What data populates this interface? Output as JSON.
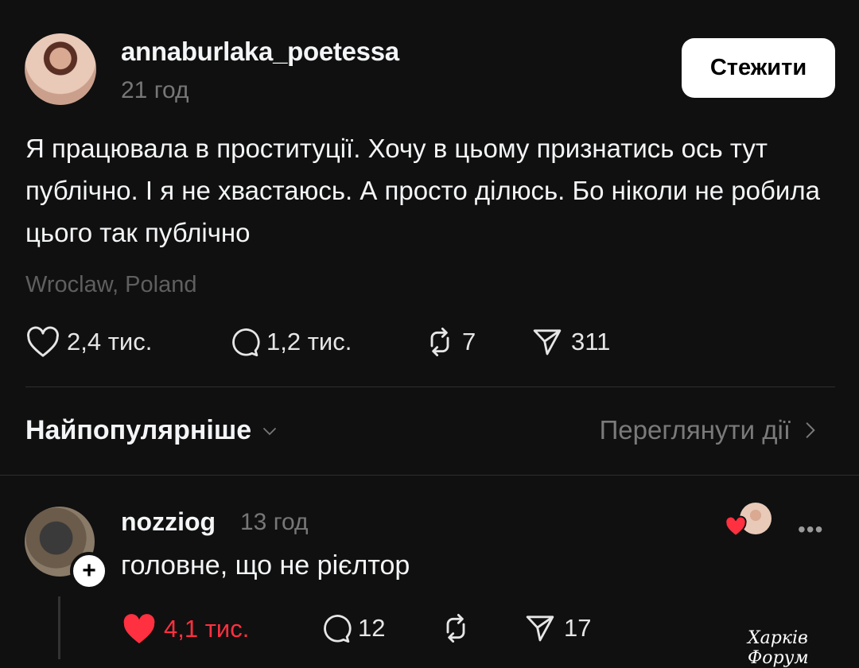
{
  "post": {
    "username": "annaburlaka_poetessa",
    "time": "21 год",
    "follow_label": "Стежити",
    "text": "Я працювала в проституції. Хочу в цьому признатись ось тут публічно. І я не хвастаюсь. А просто ділюсь. Бо ніколи не робила цього так публічно",
    "location": "Wroclaw, Poland",
    "stats": {
      "likes": "2,4 тис.",
      "comments": "1,2 тис.",
      "reposts": "7",
      "shares": "311"
    },
    "icons": [
      "heart-icon",
      "comment-icon",
      "repost-icon",
      "share-icon"
    ]
  },
  "sort": {
    "label": "Найпопулярніше",
    "activity_label": "Переглянути дії"
  },
  "comment": {
    "username": "nozziog",
    "time": "13 год",
    "text": "головне, що не рієлтор",
    "plus": "+",
    "more": "•••",
    "stats": {
      "likes": "4,1 тис.",
      "comments": "12",
      "shares": "17"
    }
  },
  "watermark": "Харків Форум",
  "colors": {
    "background": "#101010",
    "like_red": "#ff3040",
    "muted": "#777777"
  }
}
